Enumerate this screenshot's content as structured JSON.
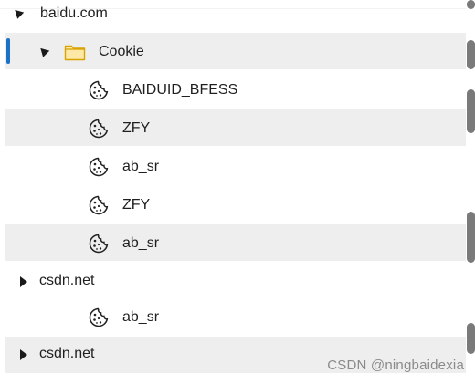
{
  "tree": {
    "nodes": [
      {
        "label": "baidu.com",
        "kind": "domain",
        "state": "expanded"
      },
      {
        "label": "Cookie",
        "kind": "folder",
        "state": "expanded",
        "icon": "folder-icon"
      },
      {
        "label": "BAIDUID_BFESS",
        "kind": "cookie",
        "icon": "cookie-icon"
      },
      {
        "label": "ZFY",
        "kind": "cookie",
        "icon": "cookie-icon"
      },
      {
        "label": "ab_sr",
        "kind": "cookie",
        "icon": "cookie-icon"
      },
      {
        "label": "ZFY",
        "kind": "cookie",
        "icon": "cookie-icon"
      },
      {
        "label": "ab_sr",
        "kind": "cookie",
        "icon": "cookie-icon"
      },
      {
        "label": "csdn.net",
        "kind": "domain",
        "state": "collapsed"
      },
      {
        "label": "ab_sr",
        "kind": "cookie",
        "icon": "cookie-icon"
      },
      {
        "label": "csdn.net",
        "kind": "domain",
        "state": "collapsed"
      }
    ]
  },
  "colors": {
    "row_band": "#eeeeee",
    "focus_accent": "#1a73c8",
    "folder_fill": "#fde9a5",
    "folder_stroke": "#d9a200"
  },
  "watermark": "CSDN @ningbaidexia"
}
